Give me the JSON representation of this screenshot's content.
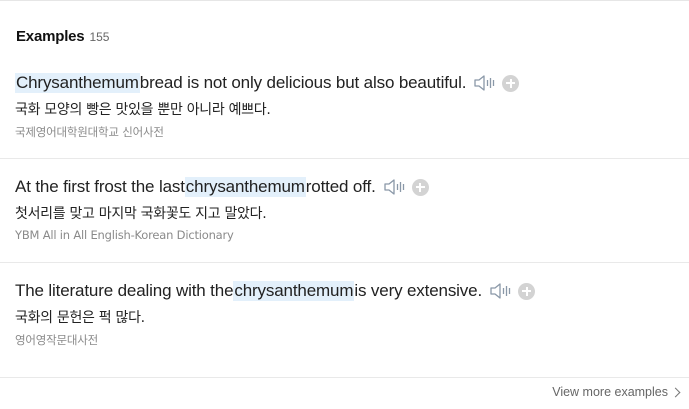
{
  "examples_section": {
    "title": "Examples",
    "count": "155",
    "items": [
      {
        "highlight": "Chrysanthemum",
        "before": "",
        "after": " bread is not only delicious but also beautiful.",
        "translation": "국화 모양의 빵은 맛있을 뿐만 아니라 예쁘다.",
        "source": "국제영어대학원대학교 신어사전",
        "speaker_icon": "speaker-icon",
        "add_icon": "plus-circle-icon"
      },
      {
        "highlight": "chrysanthemum",
        "before": "At the first frost the last ",
        "after": " rotted off.",
        "translation": "첫서리를 맞고 마지막 국화꽃도 지고 말았다.",
        "source": "YBM All in All English-Korean Dictionary",
        "speaker_icon": "speaker-icon",
        "add_icon": "plus-circle-icon"
      },
      {
        "highlight": "chrysanthemum",
        "before": "The literature dealing with the ",
        "after": " is very extensive.",
        "translation": "국화의 문헌은 퍽 많다.",
        "source": "영어영작문대사전",
        "speaker_icon": "speaker-icon",
        "add_icon": "plus-circle-icon"
      }
    ],
    "view_more": "View more examples"
  },
  "colors": {
    "highlight_bg": "#e3f0fb",
    "source_text": "#8a8a8a",
    "plus_icon": "#d3d3d3"
  }
}
